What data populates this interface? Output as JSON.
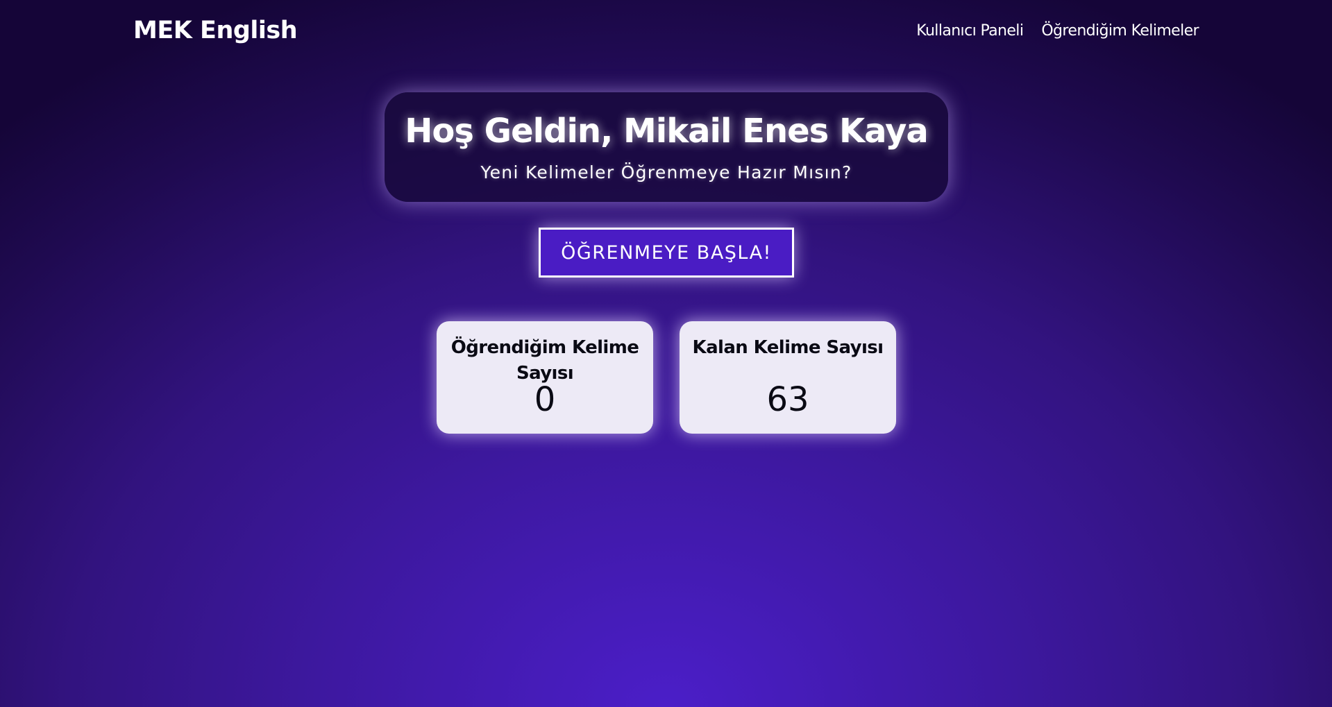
{
  "navbar": {
    "brand": "MEK English",
    "links": [
      {
        "label": "Kullanıcı Paneli"
      },
      {
        "label": "Öğrendiğim Kelimeler"
      }
    ]
  },
  "welcome": {
    "title": "Hoş Geldin, Mikail Enes Kaya",
    "subtitle": "Yeni Kelimeler Öğrenmeye Hazır Mısın?"
  },
  "start_button": {
    "label": "ÖĞRENMEYE BAŞLA!"
  },
  "stats": {
    "learned": {
      "title": "Öğrendiğim Kelime Sayısı",
      "value": "0"
    },
    "remaining": {
      "title": "Kalan Kelime Sayısı",
      "value": "63"
    }
  },
  "colors": {
    "background_center": "#4b1ec8",
    "background_edge": "#150538",
    "card_background": "#edeaf6",
    "button_background": "#4a1cc4"
  }
}
